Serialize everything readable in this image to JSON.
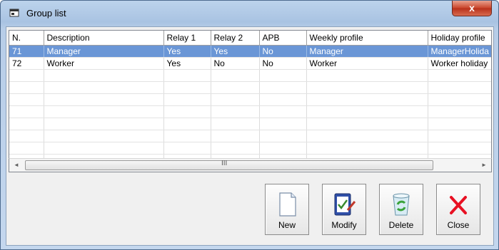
{
  "window": {
    "title": "Group list",
    "close_glyph": "x"
  },
  "grid": {
    "columns": [
      "N.",
      "Description",
      "Relay 1",
      "Relay 2",
      "APB",
      "Weekly profile",
      "Holiday profile"
    ],
    "rows": [
      {
        "cells": [
          "71",
          "Manager",
          "Yes",
          "Yes",
          "No",
          "Manager",
          "ManagerHolida"
        ],
        "selected": true
      },
      {
        "cells": [
          "72",
          "Worker",
          "Yes",
          "No",
          "No",
          "Worker",
          "Worker holiday"
        ],
        "selected": false
      }
    ],
    "empty_rows": 8
  },
  "scrollbar": {
    "left_arrow": "◄",
    "right_arrow": "►",
    "grip": "III"
  },
  "buttons": {
    "new": {
      "label": "New",
      "icon": "document-icon"
    },
    "modify": {
      "label": "Modify",
      "icon": "clipboard-check-icon"
    },
    "delete": {
      "label": "Delete",
      "icon": "recycle-bin-icon"
    },
    "close": {
      "label": "Close",
      "icon": "red-x-icon"
    }
  },
  "colors": {
    "selection": "#6a96d6",
    "close_x": "#e81123"
  }
}
